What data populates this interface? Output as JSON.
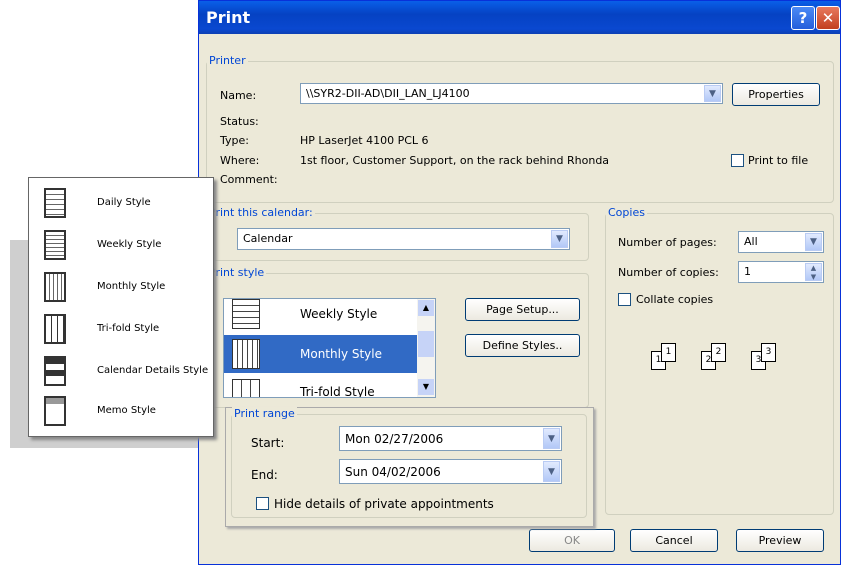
{
  "dialog": {
    "title": "Print"
  },
  "printer": {
    "legend": "Printer",
    "name_label": "Name:",
    "name_value": "\\\\SYR2-DII-AD\\DII_LAN_LJ4100",
    "properties_label": "Properties",
    "status_label": "Status:",
    "status_value": "",
    "type_label": "Type:",
    "type_value": "HP LaserJet 4100 PCL 6",
    "where_label": "Where:",
    "where_value": "1st floor, Customer Support, on the rack behind Rhonda",
    "comment_label": "Comment:",
    "print_to_file_label": "Print to file"
  },
  "calendar": {
    "legend": "Print this calendar:",
    "value": "Calendar"
  },
  "print_style": {
    "legend": "Print style",
    "items": [
      {
        "label": "Weekly Style",
        "selected": false
      },
      {
        "label": "Monthly Style",
        "selected": true
      },
      {
        "label": "Tri-fold Style",
        "selected": false
      }
    ],
    "page_setup_label": "Page Setup...",
    "define_styles_label": "Define Styles.."
  },
  "copies": {
    "legend": "Copies",
    "pages_label": "Number of pages:",
    "pages_value": "All",
    "copies_label": "Number of copies:",
    "copies_value": "1",
    "collate_label": "Collate copies",
    "collate_icon_pages": [
      "1",
      "1",
      "2",
      "2",
      "3",
      "3"
    ]
  },
  "print_range": {
    "legend": "Print range",
    "start_label": "Start:",
    "start_value": "Mon 02/27/2006",
    "end_label": "End:",
    "end_value": "Sun 04/02/2006",
    "hide_label": "Hide details of private appointments"
  },
  "footer": {
    "ok_label": "OK",
    "cancel_label": "Cancel",
    "preview_label": "Preview"
  },
  "style_panel": {
    "items": [
      {
        "label": "Daily Style",
        "icon": "daily-style-icon"
      },
      {
        "label": "Weekly Style",
        "icon": "weekly-style-icon"
      },
      {
        "label": "Monthly Style",
        "icon": "monthly-style-icon"
      },
      {
        "label": "Tri-fold Style",
        "icon": "trifold-style-icon"
      },
      {
        "label": "Calendar Details Style",
        "icon": "calendar-details-style-icon"
      },
      {
        "label": "Memo Style",
        "icon": "memo-style-icon"
      }
    ]
  }
}
